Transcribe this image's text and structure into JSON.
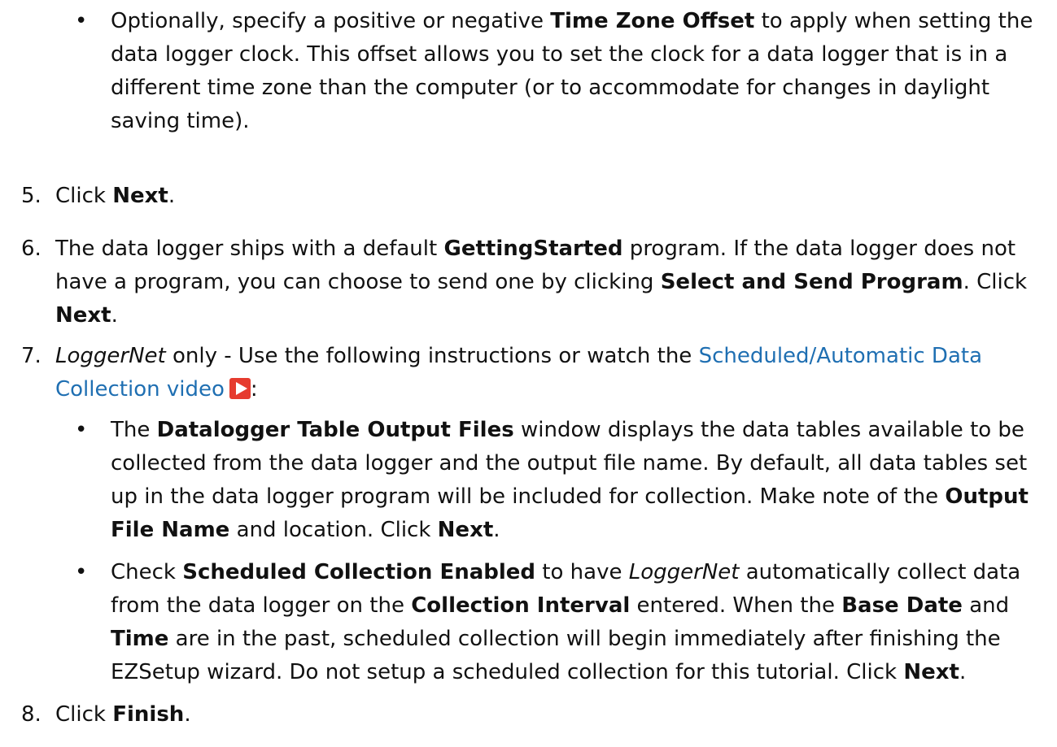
{
  "bullet_tz": {
    "a": "Optionally, specify a positive or negative ",
    "b": "Time Zone Offset",
    "c": " to apply when setting the data logger clock. This offset allows you to set the clock for a data logger that is in a different time zone than the computer (or to accommodate for changes in daylight saving time)."
  },
  "step5": {
    "num": "5.",
    "a": "Click ",
    "b": "Next",
    "c": "."
  },
  "step6": {
    "num": "6.",
    "a": "The data logger ships with a default ",
    "b": "GettingStarted",
    "c": " program. If the data logger does not have a program, you can choose to send one by clicking ",
    "d": "Select and Send Program",
    "e": ". Click ",
    "f": "Next",
    "g": "."
  },
  "step7": {
    "num": "7.",
    "a": "LoggerNet",
    "b": " only - Use the following instructions or watch the ",
    "link": "Scheduled/Automatic Data Collection video",
    "c": ":",
    "icon": "play-video-icon"
  },
  "bullet_dt": {
    "a": "The ",
    "b": "Datalogger Table Output Files",
    "c": " window displays the data tables available to be collected from the data logger and the output file name. By default, all data tables set up in the data logger program will be included for collection. Make note of the ",
    "d": "Output File Name",
    "e": " and location. Click ",
    "f": "Next",
    "g": "."
  },
  "bullet_sc": {
    "a": "Check ",
    "b": "Scheduled Collection Enabled",
    "c": " to have ",
    "d": "LoggerNet",
    "e": " automatically collect data from the data logger on the ",
    "f": "Collection Interval",
    "g": " entered. When the ",
    "h": "Base Date",
    "i": " and ",
    "j": "Time",
    "k": " are in the past, scheduled collection will begin immediately after finishing the EZSetup wizard. Do not setup a scheduled collection for this tutorial. Click ",
    "l": "Next",
    "m": "."
  },
  "step8": {
    "num": "8.",
    "a": "Click ",
    "b": "Finish",
    "c": "."
  },
  "colors": {
    "link": "#1f6fb2",
    "play_icon": "#e63b2e"
  }
}
